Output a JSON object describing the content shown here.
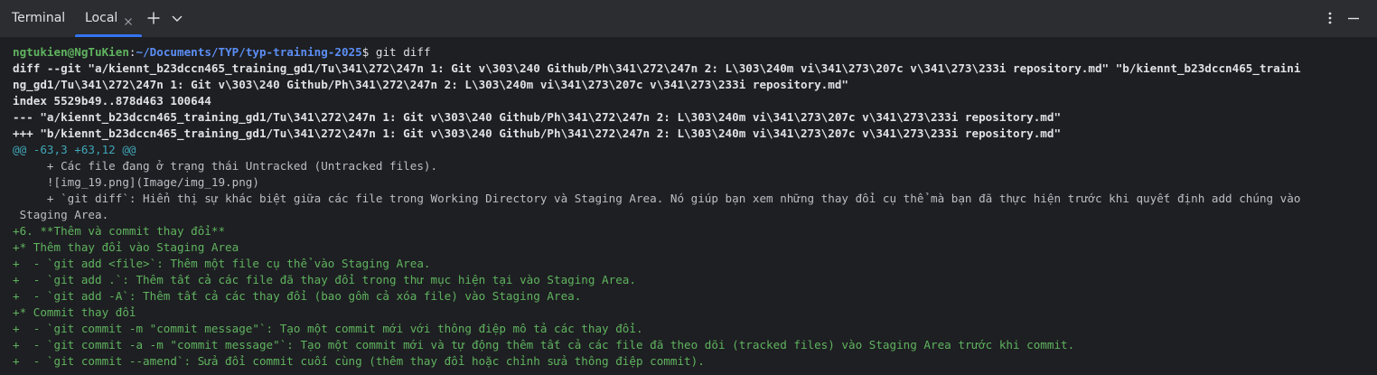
{
  "tool_window": {
    "title": "Terminal",
    "tab": {
      "label": "Local"
    }
  },
  "icons": {
    "tab_close": "close-icon",
    "new_tab": "plus-icon",
    "tab_list": "chevron-down-icon",
    "options": "more-vertical-icon",
    "hide": "minimize-icon"
  },
  "colors": {
    "background": "#1e1f22",
    "toolbar": "#2b2d30",
    "accent": "#3574f0",
    "added": "#5fb35f",
    "hunk": "#3fa6b8",
    "path": "#5b8ef5"
  },
  "prompt": {
    "user": "ngtukien@NgTuKien",
    "colon": ":",
    "path": "~/Documents/TYP/typ-training-2025",
    "symbol": "$",
    "command": " git diff"
  },
  "output": [
    {
      "type": "bold",
      "text": "diff --git \"a/kiennt_b23dccn465_training_gd1/Tu\\341\\272\\247n 1: Git v\\303\\240 Github/Ph\\341\\272\\247n 2: L\\303\\240m vi\\341\\273\\207c v\\341\\273\\233i repository.md\" \"b/kiennt_b23dccn465_traini"
    },
    {
      "type": "bold",
      "text": "ng_gd1/Tu\\341\\272\\247n 1: Git v\\303\\240 Github/Ph\\341\\272\\247n 2: L\\303\\240m vi\\341\\273\\207c v\\341\\273\\233i repository.md\""
    },
    {
      "type": "bold",
      "text": "index 5529b49..878d463 100644"
    },
    {
      "type": "bold",
      "text": "--- \"a/kiennt_b23dccn465_training_gd1/Tu\\341\\272\\247n 1: Git v\\303\\240 Github/Ph\\341\\272\\247n 2: L\\303\\240m vi\\341\\273\\207c v\\341\\273\\233i repository.md\""
    },
    {
      "type": "bold",
      "text": "+++ \"b/kiennt_b23dccn465_training_gd1/Tu\\341\\272\\247n 1: Git v\\303\\240 Github/Ph\\341\\272\\247n 2: L\\303\\240m vi\\341\\273\\207c v\\341\\273\\233i repository.md\""
    },
    {
      "type": "hunk",
      "text": "@@ -63,3 +63,12 @@"
    },
    {
      "type": "ctx",
      "text": "     + Các file đang ở trạng thái Untracked (Untracked files)."
    },
    {
      "type": "ctx",
      "text": "     ![img_19.png](Image/img_19.png)"
    },
    {
      "type": "ctx",
      "text": "     + `git diff`: Hiển thị sự khác biệt giữa các file trong Working Directory và Staging Area. Nó giúp bạn xem những thay đổi cụ thể mà bạn đã thực hiện trước khi quyết định add chúng vào"
    },
    {
      "type": "ctx",
      "text": " Staging Area."
    },
    {
      "type": "add",
      "text": "+6. **Thêm và commit thay đổi**"
    },
    {
      "type": "add",
      "text": "+* Thêm thay đổi vào Staging Area"
    },
    {
      "type": "add",
      "text": "+  - `git add <file>`: Thêm một file cụ thể vào Staging Area."
    },
    {
      "type": "add",
      "text": "+  - `git add .`: Thêm tất cả các file đã thay đổi trong thư mục hiện tại vào Staging Area."
    },
    {
      "type": "add",
      "text": "+  - `git add -A`: Thêm tất cả các thay đổi (bao gồm cả xóa file) vào Staging Area."
    },
    {
      "type": "add",
      "text": "+* Commit thay đổi"
    },
    {
      "type": "add",
      "text": "+  - `git commit -m \"commit message\"`: Tạo một commit mới với thông điệp mô tả các thay đổi."
    },
    {
      "type": "add",
      "text": "+  - `git commit -a -m \"commit message\"`: Tạo một commit mới và tự động thêm tất cả các file đã theo dõi (tracked files) vào Staging Area trước khi commit."
    },
    {
      "type": "add",
      "text": "+  - `git commit --amend`: Sửa đổi commit cuối cùng (thêm thay đổi hoặc chỉnh sửa thông điệp commit)."
    }
  ]
}
